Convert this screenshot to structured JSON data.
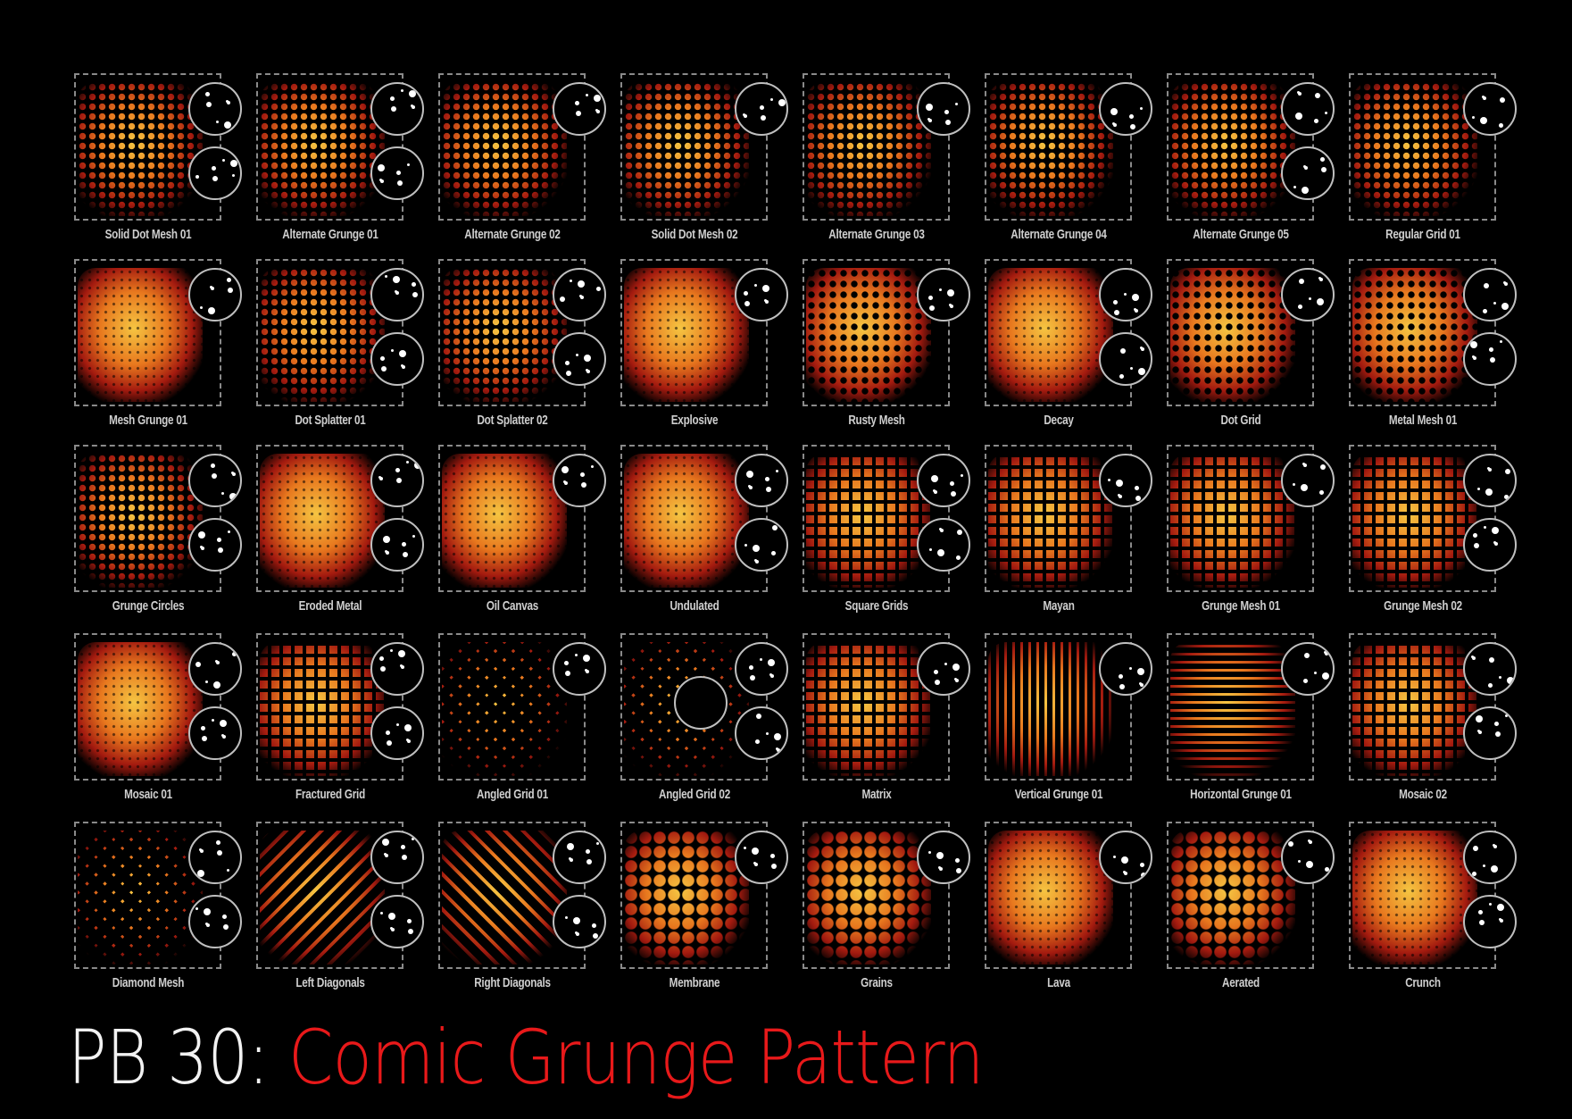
{
  "title": {
    "prefix": "PB 30:",
    "main": "Comic Grunge Pattern"
  },
  "colors": {
    "title_prefix": "#f2f2f2",
    "title_main": "#e8191a",
    "pattern_hot": "#f5c542",
    "pattern_mid": "#e8781e",
    "pattern_dark": "#a31a0f",
    "label": "#cfcfcf",
    "frame": "#8a8a8a"
  },
  "patterns": [
    {
      "name": "Solid Dot Mesh  01",
      "style": "dots",
      "brushes": 2
    },
    {
      "name": "Alternate Grunge 01",
      "style": "dots",
      "brushes": 2
    },
    {
      "name": "Alternate Grunge 02",
      "style": "dots",
      "brushes": 1
    },
    {
      "name": "Solid Dot Mesh  02",
      "style": "dots",
      "brushes": 1
    },
    {
      "name": "Alternate Grunge 03",
      "style": "dots",
      "brushes": 1
    },
    {
      "name": "Alternate Grunge 04",
      "style": "dots",
      "brushes": 1
    },
    {
      "name": "Alternate Grunge 05",
      "style": "dots",
      "brushes": 2
    },
    {
      "name": "Regular Grid 01",
      "style": "dots",
      "brushes": 1
    },
    {
      "name": "Mesh Grunge 01",
      "style": "cloud",
      "brushes": 1
    },
    {
      "name": "Dot Splatter 01",
      "style": "dots",
      "brushes": 2
    },
    {
      "name": "Dot Splatter 02",
      "style": "dots",
      "brushes": 2
    },
    {
      "name": "Explosive",
      "style": "cloud",
      "brushes": 1
    },
    {
      "name": "Rusty Mesh",
      "style": "mesh",
      "brushes": 1
    },
    {
      "name": "Decay",
      "style": "cloud",
      "brushes": 2
    },
    {
      "name": "Dot Grid",
      "style": "mesh",
      "brushes": 1
    },
    {
      "name": "Metal Mesh 01",
      "style": "mesh",
      "brushes": 2
    },
    {
      "name": "Grunge Circles",
      "style": "dots",
      "brushes": 2
    },
    {
      "name": "Eroded Metal",
      "style": "cloud",
      "brushes": 2
    },
    {
      "name": "Oil Canvas",
      "style": "cloud",
      "brushes": 1
    },
    {
      "name": "Undulated",
      "style": "cloud",
      "brushes": 2
    },
    {
      "name": "Square Grids",
      "style": "grid",
      "brushes": 2
    },
    {
      "name": "Mayan",
      "style": "grid",
      "brushes": 1
    },
    {
      "name": "Grunge Mesh 01",
      "style": "grid",
      "brushes": 1
    },
    {
      "name": "Grunge Mesh 02",
      "style": "grid",
      "brushes": 2
    },
    {
      "name": "Mosaic 01",
      "style": "cloud",
      "brushes": 2
    },
    {
      "name": "Fractured Grid",
      "style": "grid",
      "brushes": 2
    },
    {
      "name": "Angled Grid 01",
      "style": "diag",
      "brushes": 1
    },
    {
      "name": "Angled Grid 02",
      "style": "diag",
      "brushes": 3
    },
    {
      "name": "Matrix",
      "style": "grid",
      "brushes": 1
    },
    {
      "name": "Vertical Grunge 01",
      "style": "vert",
      "brushes": 1
    },
    {
      "name": "Horizontal Grunge 01",
      "style": "horiz",
      "brushes": 1
    },
    {
      "name": "Mosaic 02",
      "style": "grid",
      "brushes": 2
    },
    {
      "name": "Diamond Mesh",
      "style": "diag",
      "brushes": 2
    },
    {
      "name": "Left Diagonals",
      "style": "ldiag",
      "brushes": 2
    },
    {
      "name": "Right Diagonals",
      "style": "rdiag",
      "brushes": 2
    },
    {
      "name": "Membrane",
      "style": "cells",
      "brushes": 1
    },
    {
      "name": "Grains",
      "style": "cells",
      "brushes": 1
    },
    {
      "name": "Lava",
      "style": "cloud",
      "brushes": 1
    },
    {
      "name": "Aerated",
      "style": "cells",
      "brushes": 1
    },
    {
      "name": "Crunch",
      "style": "cloud",
      "brushes": 2
    }
  ]
}
